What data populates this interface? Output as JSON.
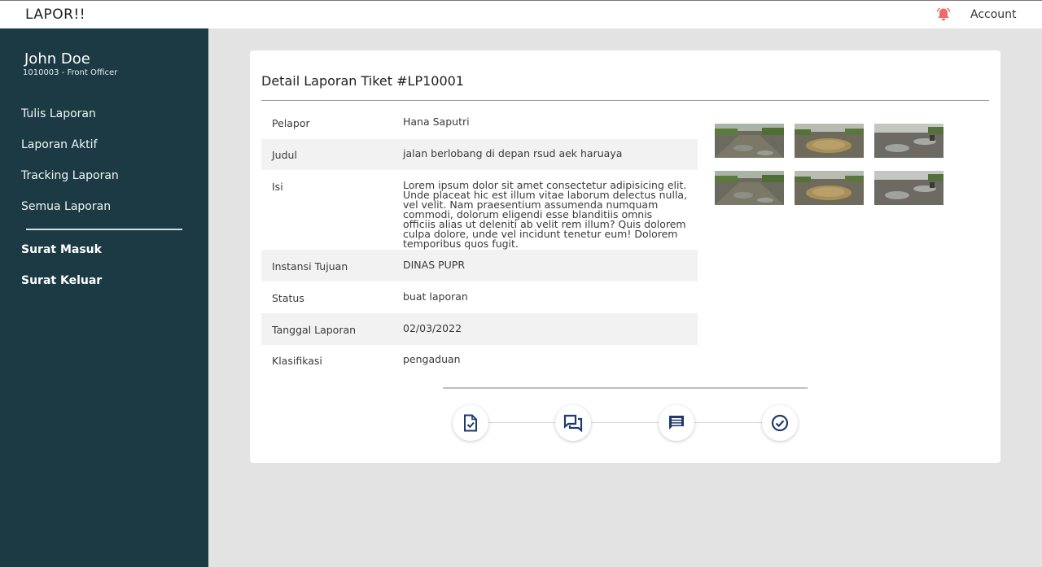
{
  "app": {
    "brand": "LAPOR!!",
    "account_label": "Account"
  },
  "sidebar": {
    "user_name": "John Doe",
    "user_role": "1010003 - Front Officer",
    "menu": [
      "Tulis Laporan",
      "Laporan Aktif",
      "Tracking Laporan",
      "Semua Laporan"
    ],
    "mail": [
      "Surat Masuk",
      "Surat Keluar"
    ]
  },
  "detail": {
    "title": "Detail Laporan Tiket #LP10001",
    "rows": [
      {
        "label": "Pelapor",
        "value": "Hana Saputri"
      },
      {
        "label": "Judul",
        "value": "jalan berlobang di depan rsud aek haruaya"
      },
      {
        "label": "Isi",
        "value": "Lorem ipsum dolor sit amet consectetur adipisicing elit. Unde placeat hic est illum vitae laborum delectus nulla, vel velit. Nam praesentium assumenda numquam commodi, dolorum eligendi esse blanditiis omnis officiis alias ut deleniti ab velit rem illum? Quis dolorem culpa dolore, unde vel incidunt tenetur eum! Dolorem temporibus quos fugit."
      },
      {
        "label": "Instansi Tujuan",
        "value": "DINAS PUPR"
      },
      {
        "label": "Status",
        "value": "buat laporan"
      },
      {
        "label": "Tanggal Laporan",
        "value": "02/03/2022"
      },
      {
        "label": "Klasifikasi",
        "value": "pengaduan"
      }
    ]
  },
  "photos": [
    "road-photo-1",
    "road-photo-2",
    "road-photo-3",
    "road-photo-1",
    "road-photo-2",
    "road-photo-3"
  ],
  "steps": [
    "document-check-icon",
    "chat-bubbles-icon",
    "message-icon",
    "check-circle-icon"
  ],
  "colors": {
    "sidebar": "#1c3a44",
    "background": "#e3e3e3",
    "icon": "#1e3a6e",
    "bell": "#ef6b6b"
  }
}
